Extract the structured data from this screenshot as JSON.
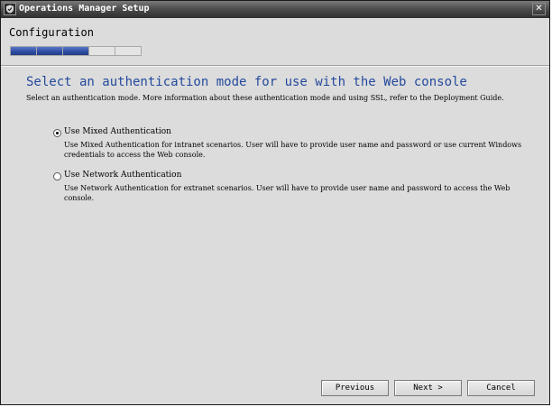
{
  "window": {
    "title": "Operations Manager Setup",
    "close_glyph": "✕"
  },
  "header": {
    "title": "Configuration",
    "progress": {
      "completed_segments": 3,
      "total_segments": 5
    }
  },
  "page": {
    "heading": "Select an authentication mode for use with the Web console",
    "intro": "Select an authentication mode. More information about these authentication mode and using SSL, refer to the Deployment Guide."
  },
  "options": [
    {
      "label": "Use Mixed Authentication",
      "description": "Use Mixed Authentication for intranet scenarios. User will have to provide user name and password or use current Windows credentials to access the Web console.",
      "selected": true
    },
    {
      "label": "Use Network Authentication",
      "description": "Use Network Authentication for extranet scenarios. User will have to provide user name and password to access the Web console.",
      "selected": false
    }
  ],
  "buttons": {
    "previous": "Previous",
    "next": "Next >",
    "cancel": "Cancel"
  },
  "colors": {
    "heading": "#244a9c",
    "progress_fill": "#2f4fa5",
    "background": "#dcdcdc"
  },
  "icons": {
    "app": "setup-shield-icon",
    "close": "close-icon"
  }
}
